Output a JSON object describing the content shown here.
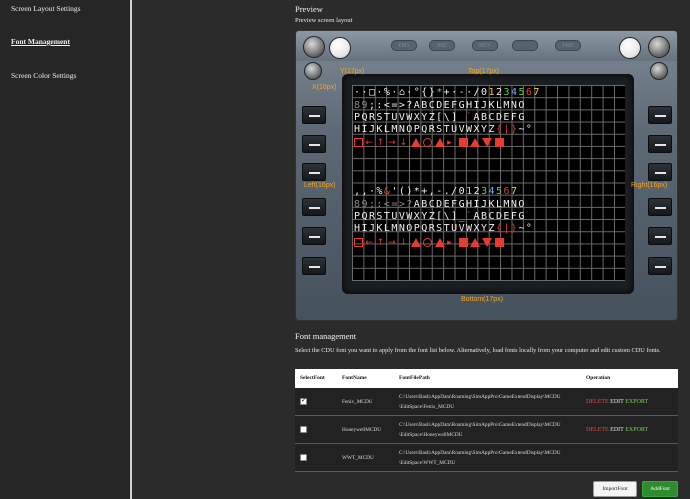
{
  "sidebar": {
    "items": [
      {
        "label": "Screen Layout Settings"
      },
      {
        "label": "Font Management"
      },
      {
        "label": "Screen Color Settings"
      }
    ]
  },
  "preview": {
    "title": "Preview",
    "subtitle": "Preview screen layout",
    "annunciators": [
      "FM1",
      "IND",
      "RDY",
      "",
      "FM2"
    ],
    "labels": {
      "y": "Y(17px)",
      "x": "X(16px)",
      "top": "Top(17px)",
      "left": "Left(16px)",
      "right": "Right(16px)",
      "bottom": "Bottom(17px)"
    },
    "rows": [
      "  · □ ·% ⌂ °{ }<>#+ - /0123456⁷",
      "89;:<=>?ABCDEFGHIJKLMNO",
      "PQRSTUVWXYZ[\\]^_`ABCDEFG",
      "HIJKLMNOPQRSTUVWXYZ{|}~°",
      "  , , ·%&'()*+,-./01234567",
      "89;:<=>?ABCDEFGHIJKLMNO",
      "PQRSTUVWXYZ[\\]^_`ABCDEFG",
      "HIJKLMNOPQRSTUVWXYZ{|}~°"
    ]
  },
  "font_management": {
    "title": "Font management",
    "description": "Select the CDU font you want to apply from the font list below. Alternatively, load fonts locally from your computer and edit custom CDU fonts.",
    "columns": [
      "SelectFont",
      "FontName",
      "FontFilePath",
      "Operation"
    ],
    "rows": [
      {
        "selected": true,
        "name": "Fenix_MCDU",
        "path1": "C:\\Users\\Bash\\AppData\\Roaming\\SimAppPro\\GameExtendDisplay\\MCDU",
        "path2": "\\EditSpace\\Fenix_MCDU",
        "ops": true
      },
      {
        "selected": false,
        "name": "HoneywellMCDU",
        "path1": "C:\\Users\\Bash\\AppData\\Roaming\\SimAppPro\\GameExtendDisplay\\MCDU",
        "path2": "\\EditSpace\\HoneywellMCDU",
        "ops": true
      },
      {
        "selected": false,
        "name": "WWT_MCDU",
        "path1": "C:\\Users\\Bash\\AppData\\Roaming\\SimAppPro\\GameExtendDisplay\\MCDU",
        "path2": "\\EditSpace\\WWT_MCDU",
        "ops": false
      }
    ],
    "ops": {
      "delete": "DELETE",
      "edit": "EDIT",
      "export": "EXPORT"
    },
    "buttons": {
      "import": "ImportFont",
      "add": "AddFont"
    }
  },
  "colors": {
    "accent_green": "#2e8b2e",
    "delete_red": "#e05050",
    "export_green": "#7fcf5a",
    "label_orange": "#f5a623"
  }
}
